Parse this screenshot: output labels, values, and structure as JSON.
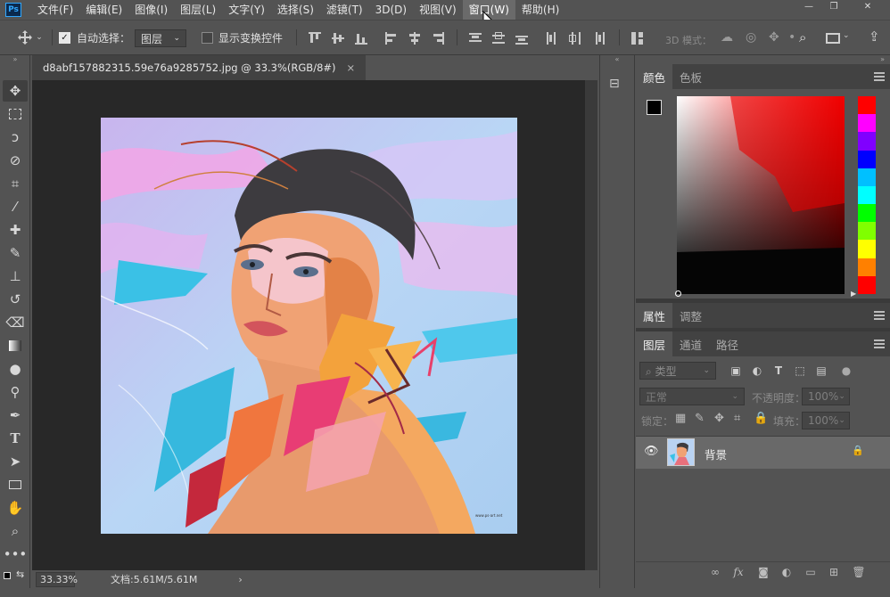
{
  "app": {
    "logo": "Ps"
  },
  "menubar": {
    "items": [
      "文件(F)",
      "编辑(E)",
      "图像(I)",
      "图层(L)",
      "文字(Y)",
      "选择(S)",
      "滤镜(T)",
      "3D(D)",
      "视图(V)",
      "窗口(W)",
      "帮助(H)"
    ],
    "hovered_index": 9
  },
  "window_controls": {
    "minimize": "—",
    "restore": "❐",
    "close": "✕"
  },
  "options_bar": {
    "auto_select_label": "自动选择：",
    "auto_select_checked": true,
    "auto_select_target": "图层",
    "show_transform_label": "显示变换控件",
    "show_transform_checked": false,
    "mode_3d_label": "3D 模式："
  },
  "document": {
    "tab_title": "d8abf157882315.59e76a9285752.jpg @ 33.3%(RGB/8#)",
    "close_glyph": "×",
    "artwork_caption": "www.ps-art.net"
  },
  "status_bar": {
    "zoom": "33.33%",
    "doc_size": "文档:5.61M/5.61M",
    "arrow": "›"
  },
  "panels": {
    "color_tabs": [
      "颜色",
      "色板"
    ],
    "properties_tabs": [
      "属性",
      "调整"
    ],
    "layers_tabs": [
      "图层",
      "通道",
      "路径"
    ],
    "filter_kind": "类型",
    "blend_mode": "正常",
    "opacity_label": "不透明度：",
    "opacity_value": "100%",
    "lock_label": "锁定：",
    "fill_label": "填充：",
    "fill_value": "100%",
    "layer": {
      "name": "背景",
      "visible": true,
      "locked": true
    }
  },
  "colors": {
    "foreground": "#000000",
    "background": "#ffffff",
    "hue_strip": [
      "#ff0000",
      "#ff00ff",
      "#8000ff",
      "#0000ff",
      "#00c0ff",
      "#00ffff",
      "#00ff00",
      "#80ff00",
      "#ffff00",
      "#ff8000",
      "#ff0000"
    ]
  }
}
